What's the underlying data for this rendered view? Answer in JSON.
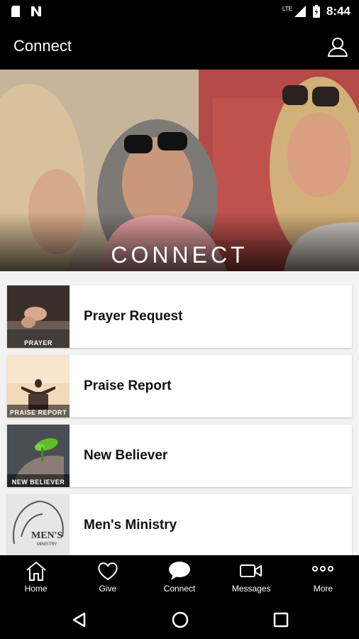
{
  "status": {
    "time": "8:44",
    "network": "LTE"
  },
  "app_bar": {
    "title": "Connect"
  },
  "hero": {
    "title": "CONNECT"
  },
  "items": [
    {
      "label": "Prayer Request",
      "thumb_caption": "PRAYER"
    },
    {
      "label": "Praise Report",
      "thumb_caption": "PRAISE REPORT"
    },
    {
      "label": "New Believer",
      "thumb_caption": "NEW BELIEVER"
    },
    {
      "label": "Men's Ministry",
      "thumb_caption": "MEN'S MINISTRY"
    }
  ],
  "bottom_nav": [
    {
      "label": "Home",
      "icon": "home-icon"
    },
    {
      "label": "Give",
      "icon": "heart-icon"
    },
    {
      "label": "Connect",
      "icon": "chat-bubble-icon"
    },
    {
      "label": "Messages",
      "icon": "video-icon"
    },
    {
      "label": "More",
      "icon": "more-dots-icon"
    }
  ],
  "colors": {
    "background": "#000000",
    "list_bg": "#f2f2f2",
    "card": "#ffffff",
    "text": "#111111"
  }
}
